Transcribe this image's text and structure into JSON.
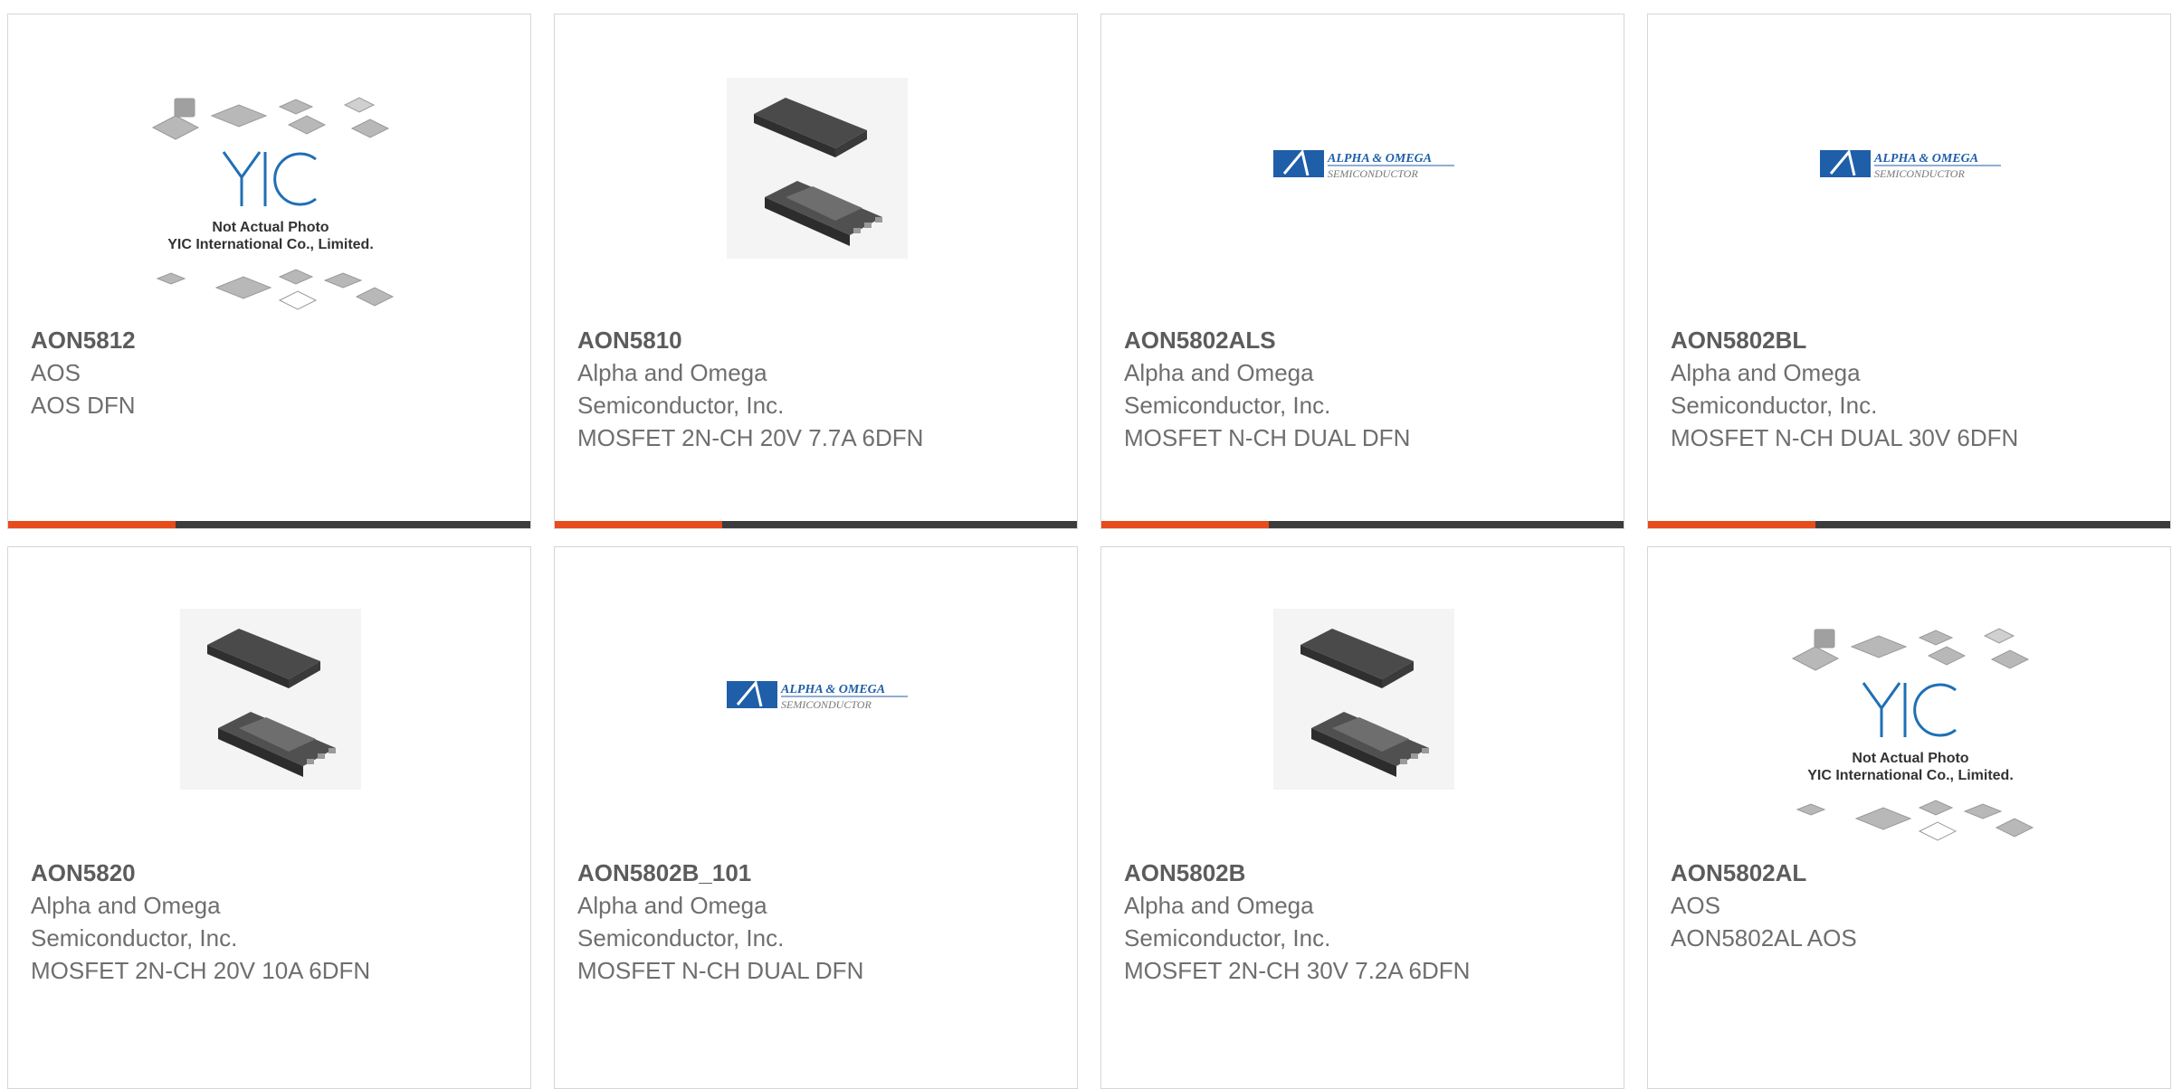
{
  "cards": [
    {
      "part": "AON5812",
      "lines": [
        "AOS",
        "AOS DFN"
      ],
      "image": "not-actual-photo",
      "image_text": [
        "Not Actual Photo",
        "YIC International Co., Limited."
      ]
    },
    {
      "part": "AON5810",
      "lines": [
        "Alpha and Omega",
        "Semiconductor, Inc.",
        "MOSFET 2N-CH 20V 7.7A 6DFN"
      ],
      "image": "dfn-package-photo"
    },
    {
      "part": "AON5802ALS",
      "lines": [
        "Alpha and Omega",
        "Semiconductor, Inc.",
        "MOSFET N-CH DUAL DFN"
      ],
      "image": "alpha-omega-logo",
      "logo_text": [
        "ALPHA & OMEGA",
        "SEMICONDUCTOR"
      ]
    },
    {
      "part": "AON5802BL",
      "lines": [
        "Alpha and Omega",
        "Semiconductor, Inc.",
        "MOSFET N-CH DUAL 30V 6DFN"
      ],
      "image": "alpha-omega-logo",
      "logo_text": [
        "ALPHA & OMEGA",
        "SEMICONDUCTOR"
      ]
    },
    {
      "part": "AON5820",
      "lines": [
        "Alpha and Omega",
        "Semiconductor, Inc.",
        "MOSFET 2N-CH 20V 10A 6DFN"
      ],
      "image": "dfn-package-photo"
    },
    {
      "part": "AON5802B_101",
      "lines": [
        "Alpha and Omega",
        "Semiconductor, Inc.",
        "MOSFET N-CH DUAL DFN"
      ],
      "image": "alpha-omega-logo",
      "logo_text": [
        "ALPHA & OMEGA",
        "SEMICONDUCTOR"
      ]
    },
    {
      "part": "AON5802B",
      "lines": [
        "Alpha and Omega",
        "Semiconductor, Inc.",
        "MOSFET 2N-CH 30V 7.2A 6DFN"
      ],
      "image": "dfn-package-photo"
    },
    {
      "part": "AON5802AL",
      "lines": [
        "AOS",
        "AON5802AL AOS"
      ],
      "image": "not-actual-photo",
      "image_text": [
        "Not Actual Photo",
        "YIC International Co., Limited."
      ]
    }
  ],
  "colors": {
    "accent": "#e84b1c",
    "bar": "#3c3c3c",
    "border": "#d6d6d6",
    "text": "#6e6e6e",
    "logo_blue": "#1f5ea8"
  },
  "first_row_bar_fraction": 0.32
}
